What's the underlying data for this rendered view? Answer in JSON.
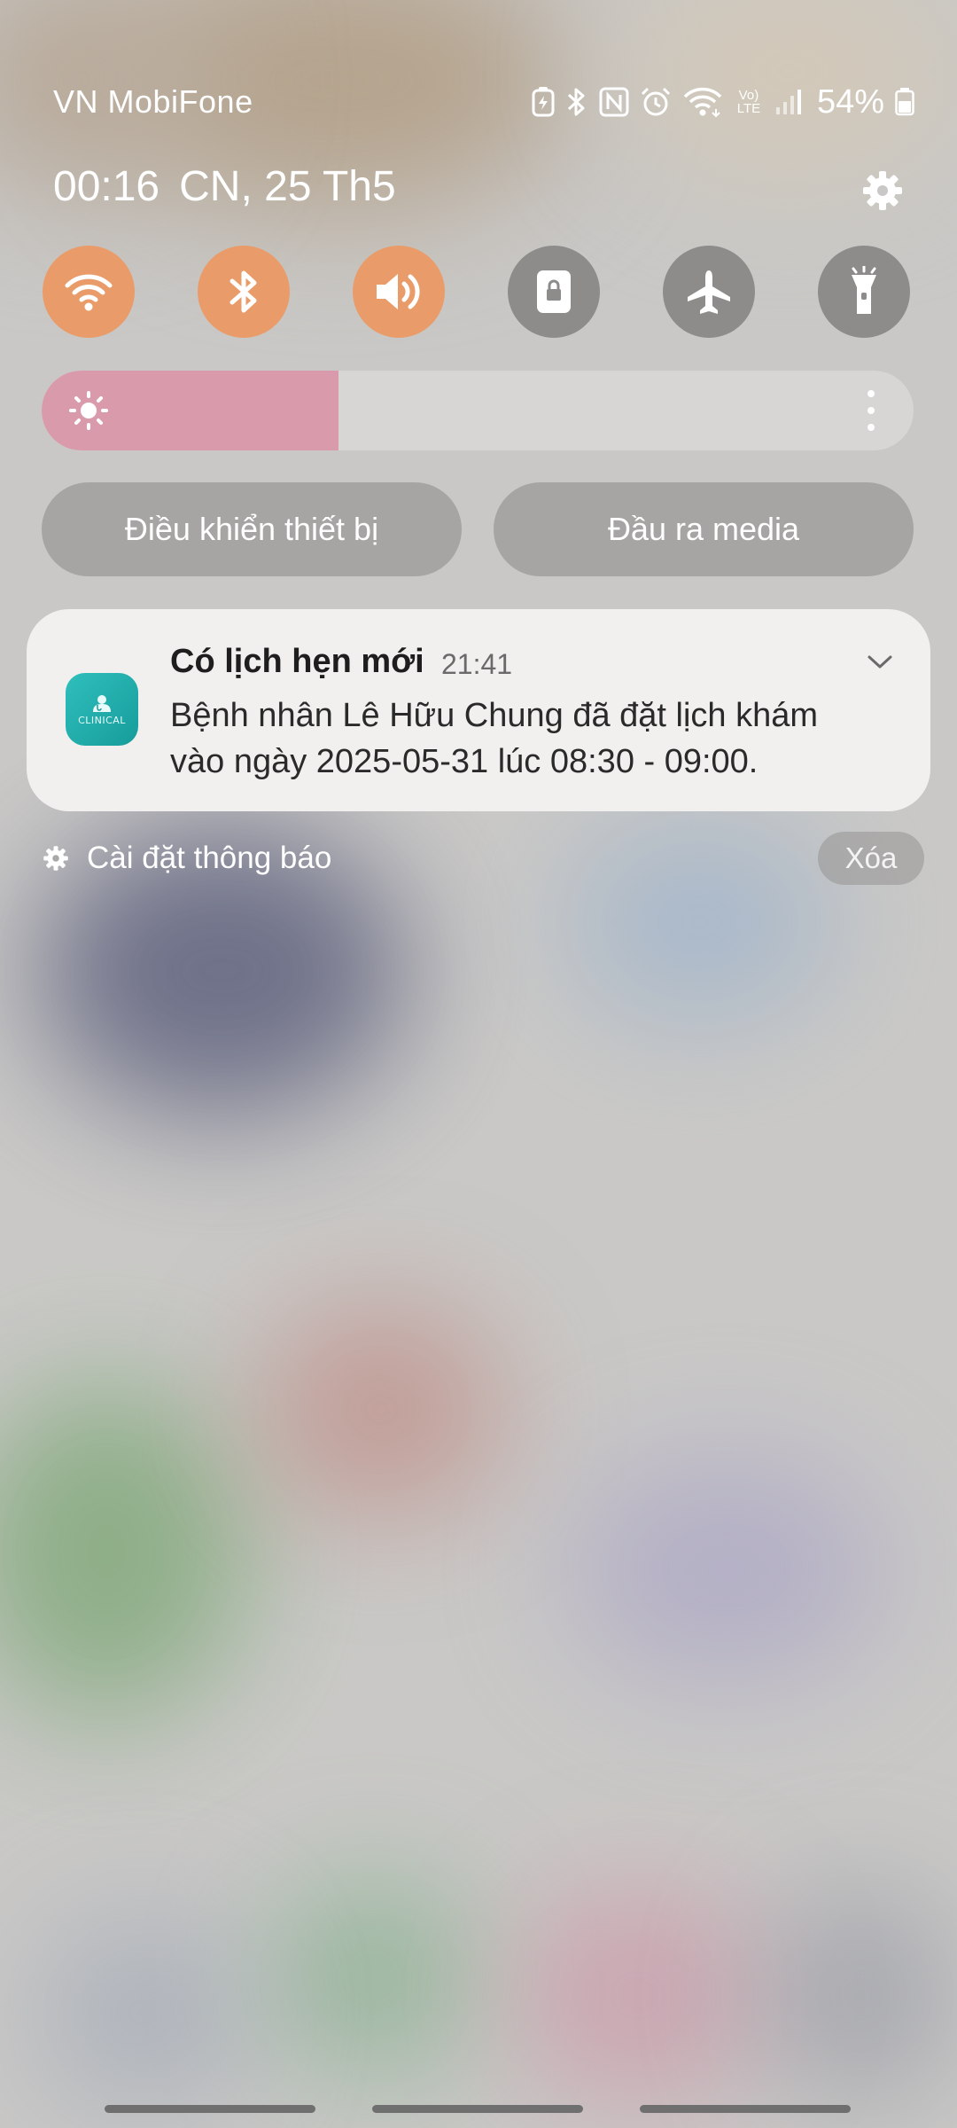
{
  "status_bar": {
    "carrier": "VN MobiFone",
    "battery_percent": "54%",
    "icons": [
      "battery-saver-icon",
      "bluetooth-icon",
      "nfc-icon",
      "alarm-icon",
      "wifi-icon",
      "volte-icon",
      "signal-icon",
      "battery-icon"
    ],
    "volte_label": "Vo) LTE"
  },
  "header": {
    "time": "00:16",
    "date": "CN, 25 Th5"
  },
  "quick_toggles": [
    {
      "icon": "wifi-icon",
      "state": "on"
    },
    {
      "icon": "bluetooth-icon",
      "state": "on"
    },
    {
      "icon": "sound-icon",
      "state": "on"
    },
    {
      "icon": "screen-lock-icon",
      "state": "off"
    },
    {
      "icon": "airplane-icon",
      "state": "off"
    },
    {
      "icon": "flashlight-icon",
      "state": "off"
    }
  ],
  "brightness": {
    "level": 0.34
  },
  "buttons": {
    "device_control": "Điều khiển thiết bị",
    "media_output": "Đầu ra media"
  },
  "notification": {
    "app_icon_text": "CLINICAL",
    "title": "Có lịch hẹn mới",
    "time": "21:41",
    "body_line1": "Bệnh nhân Lê Hữu Chung đã đặt lịch khám",
    "body_line2": "vào ngày 2025-05-31 lúc 08:30 - 09:00."
  },
  "notification_settings": {
    "label": "Cài đặt thông báo",
    "clear": "Xóa"
  },
  "colors": {
    "toggle_on": "#e99c69",
    "toggle_off": "#8e8c8a",
    "brightness_fill": "#d99bab",
    "app_icon": "#1fa8a6"
  }
}
